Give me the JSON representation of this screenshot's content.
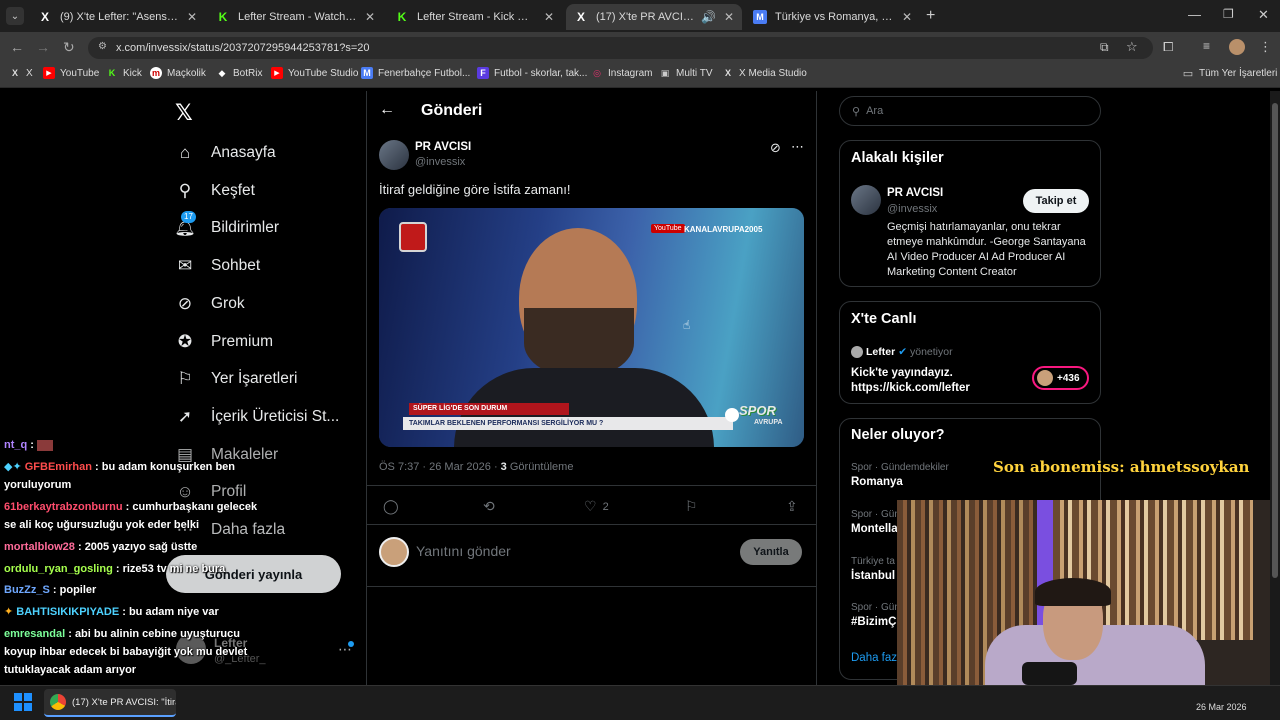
{
  "tabs": [
    {
      "label": "(9) X'te Lefter: \"Asensio'yu göre\"",
      "fav": "X",
      "favcolor": "#ffffff"
    },
    {
      "label": "Lefter Stream - Watch Live on Kick",
      "fav": "K",
      "favcolor": "#53fc18"
    },
    {
      "label": "Lefter Stream - Kick Dashboard",
      "fav": "K",
      "favcolor": "#53fc18"
    },
    {
      "label": "(17) X'te PR AVCISI: \"İtiraf ge",
      "fav": "X",
      "favcolor": "#ffffff"
    },
    {
      "label": "Türkiye vs Romanya, 26.03.2026",
      "fav": "M",
      "favcolor": "#4a7cf4"
    }
  ],
  "url": "x.com/invessix/status/2037207295944253781?s=20",
  "bookmarks": [
    {
      "label": "X",
      "icon": "X"
    },
    {
      "label": "YouTube",
      "icon": "▶"
    },
    {
      "label": "Kick",
      "icon": "K"
    },
    {
      "label": "Maçkolik",
      "icon": "m"
    },
    {
      "label": "BotRix",
      "icon": "◆"
    },
    {
      "label": "YouTube Studio",
      "icon": "▶"
    },
    {
      "label": "Fenerbahçe Futbol...",
      "icon": "M"
    },
    {
      "label": "Futbol - skorlar, tak...",
      "icon": "F"
    },
    {
      "label": "Instagram",
      "icon": "◎"
    },
    {
      "label": "Multi TV",
      "icon": "▣"
    },
    {
      "label": "X Media Studio",
      "icon": "X"
    }
  ],
  "bookmarks_all": "Tüm Yer İşaretleri",
  "nav": {
    "home": "Anasayfa",
    "explore": "Keşfet",
    "notifications": "Bildirimler",
    "notif_badge": "17",
    "chat": "Sohbet",
    "grok": "Grok",
    "premium": "Premium",
    "bookmarks": "Yer İşaretleri",
    "creator": "İçerik Üreticisi St...",
    "articles": "Makaleler",
    "profile": "Profil",
    "more": "Daha fazla",
    "post_button": "Gönderi yayınla",
    "account_name": "Lefter",
    "account_handle": "@_Lefter_"
  },
  "post": {
    "header": "Gönderi",
    "author": "PR AVCISI",
    "handle": "@invessix",
    "text": "İtiraf geldiğine göre İstifa zamanı!",
    "time": "ÖS 7:37 · 26 Mar 2026 · ",
    "views_count": "3",
    "views_label": " Görüntüleme",
    "likes": "2",
    "reply_placeholder": "Yanıtını gönder",
    "reply_button": "Yanıtla",
    "video": {
      "watermark": "KANALAVRUPA2005",
      "ticker_top": "SÜPER LİG'DE SON DURUM",
      "ticker": "TAKIMLAR BEKLENEN PERFORMANSI SERGİLİYOR MU ?",
      "logo": "SPOR",
      "logo2": "AVRUPA",
      "yt": "YouTube"
    }
  },
  "right": {
    "search_placeholder": "Ara",
    "related_title": "Alakalı kişiler",
    "rel_name": "PR AVCISI",
    "rel_handle": "@invessix",
    "follow": "Takip et",
    "rel_bio": "Geçmişi hatırlamayanlar, onu tekrar etmeye mahkûmdur. -George Santayana AI Video Producer AI Ad Producer AI Marketing Content Creator",
    "live_title": "X'te Canlı",
    "live_host": "Lefter",
    "live_role": "yönetiyor",
    "live_text": "Kick'te yayındayız. https://kick.com/lefter",
    "live_count": "+436",
    "trends_title": "Neler oluyor?",
    "trends": [
      {
        "cat": "Spor · Gündemdekiler",
        "name": "Romanya"
      },
      {
        "cat": "Spor · Gün",
        "name": "Montella"
      },
      {
        "cat": "Türkiye ta",
        "name": "İstanbul"
      },
      {
        "cat": "Spor · Gün",
        "name": "#BizimÇ"
      }
    ],
    "more": "Daha faz"
  },
  "overlay": {
    "sub": "Son abonemiss: ahmetssoykan"
  },
  "chat": [
    {
      "user": "nt_q",
      "msg": ":",
      "color": "#b084ff"
    },
    {
      "user": "GFBEmirhan",
      "msg": ": bu adam konuşurken ben yoruluyorum",
      "color": "#ff4d4d"
    },
    {
      "user": "61berkaytrabzonburnu",
      "msg": ": cumhurbaşkanı gelecek se ali koç uğursuzluğu yok eder belki",
      "color": "#ff4d6d"
    },
    {
      "user": "mortalblow28",
      "msg": ": 2005 yazıyo sağ üstte",
      "color": "#ff6b9a"
    },
    {
      "user": "ordulu_ryan_gosling",
      "msg": ": rize53 tv mi ne bura",
      "color": "#a6ff4d"
    },
    {
      "user": "BuzZz_S",
      "msg": ": popiler",
      "color": "#6fa8ff"
    },
    {
      "user": "BAHTISIKIKPIYADE",
      "msg": ": bu adam niye var",
      "color": "#4dd2ff"
    },
    {
      "user": "emresandal",
      "msg": ": abi bu alinin cebine uyuşturucu koyup ihbar edecek bi babayiğit yok mu devlet tutuklayacak adam arıyor",
      "color": "#7dff9a"
    }
  ],
  "taskbar": {
    "app": "(17) X'te PR AVCISI: \"İtira",
    "date": "26 Mar 2026"
  }
}
